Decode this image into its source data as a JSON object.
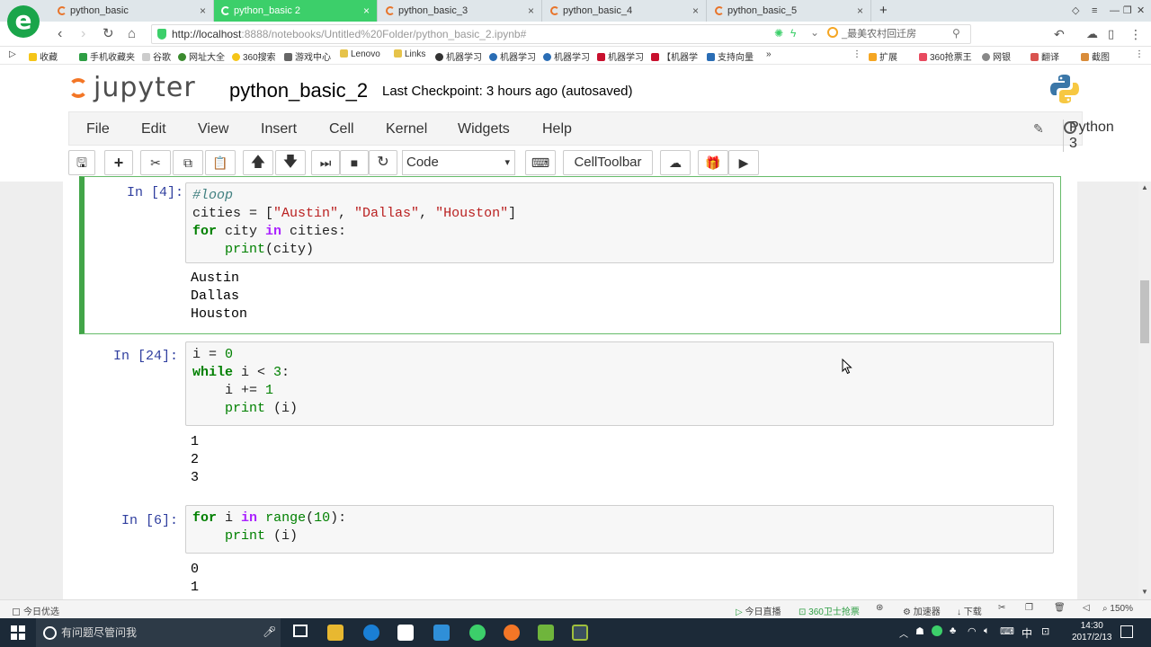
{
  "browser": {
    "tabs": [
      {
        "label": "python_basic",
        "close": "×"
      },
      {
        "label": "python_basic 2",
        "close": "×"
      },
      {
        "label": "python_basic_3",
        "close": "×"
      },
      {
        "label": "python_basic_4",
        "close": "×"
      },
      {
        "label": "python_basic_5",
        "close": "×"
      }
    ],
    "new_tab": "+",
    "url_host": "http://localhost",
    "url_rest": ":8888/notebooks/Untitled%20Folder/python_basic_2.ipynb#",
    "search_hint": "_最美农村回迁房",
    "bookmarks": [
      "收藏",
      "手机收藏夹",
      "谷歌",
      "网址大全",
      "360搜索",
      "游戏中心",
      "Lenovo",
      "Links",
      "机器学习",
      "机器学习",
      "机器学习",
      "机器学习",
      "【机器学",
      "支持向量",
      "»"
    ],
    "bookmarks_right": [
      "扩展",
      "360抢票王",
      "网银",
      "翻译",
      "截图"
    ]
  },
  "jupyter": {
    "logo_text": "jupyter",
    "notebook_name": "python_basic_2",
    "checkpoint": "Last Checkpoint: 3 hours ago (autosaved)",
    "menu": [
      "File",
      "Edit",
      "View",
      "Insert",
      "Cell",
      "Kernel",
      "Widgets",
      "Help"
    ],
    "kernel_name": "Python 3",
    "cell_type": "Code",
    "celltoolbar_label": "CellToolbar"
  },
  "cells": [
    {
      "prompt": "In [4]:",
      "outputs": [
        "Austin",
        "Dallas",
        "Houston"
      ]
    },
    {
      "prompt": "In [24]:",
      "outputs": [
        "1",
        "2",
        "3"
      ]
    },
    {
      "prompt": "In [6]:",
      "outputs": [
        "0",
        "1"
      ]
    }
  ],
  "statusbar": {
    "left": "今日优选",
    "items": [
      "今日直播",
      "360卫士抢票",
      "加速器",
      "下载",
      "150%"
    ]
  },
  "taskbar": {
    "search_placeholder": "有问题尽管问我",
    "ime": "中",
    "time": "14:30",
    "date": "2017/2/13"
  },
  "colors": {
    "tab_active": "#3ccf6a",
    "jupyter_orange": "#f37626",
    "selected_cell_border": "#42a548",
    "prompt_blue": "#303f9f",
    "taskbar": "#1c2a38"
  }
}
